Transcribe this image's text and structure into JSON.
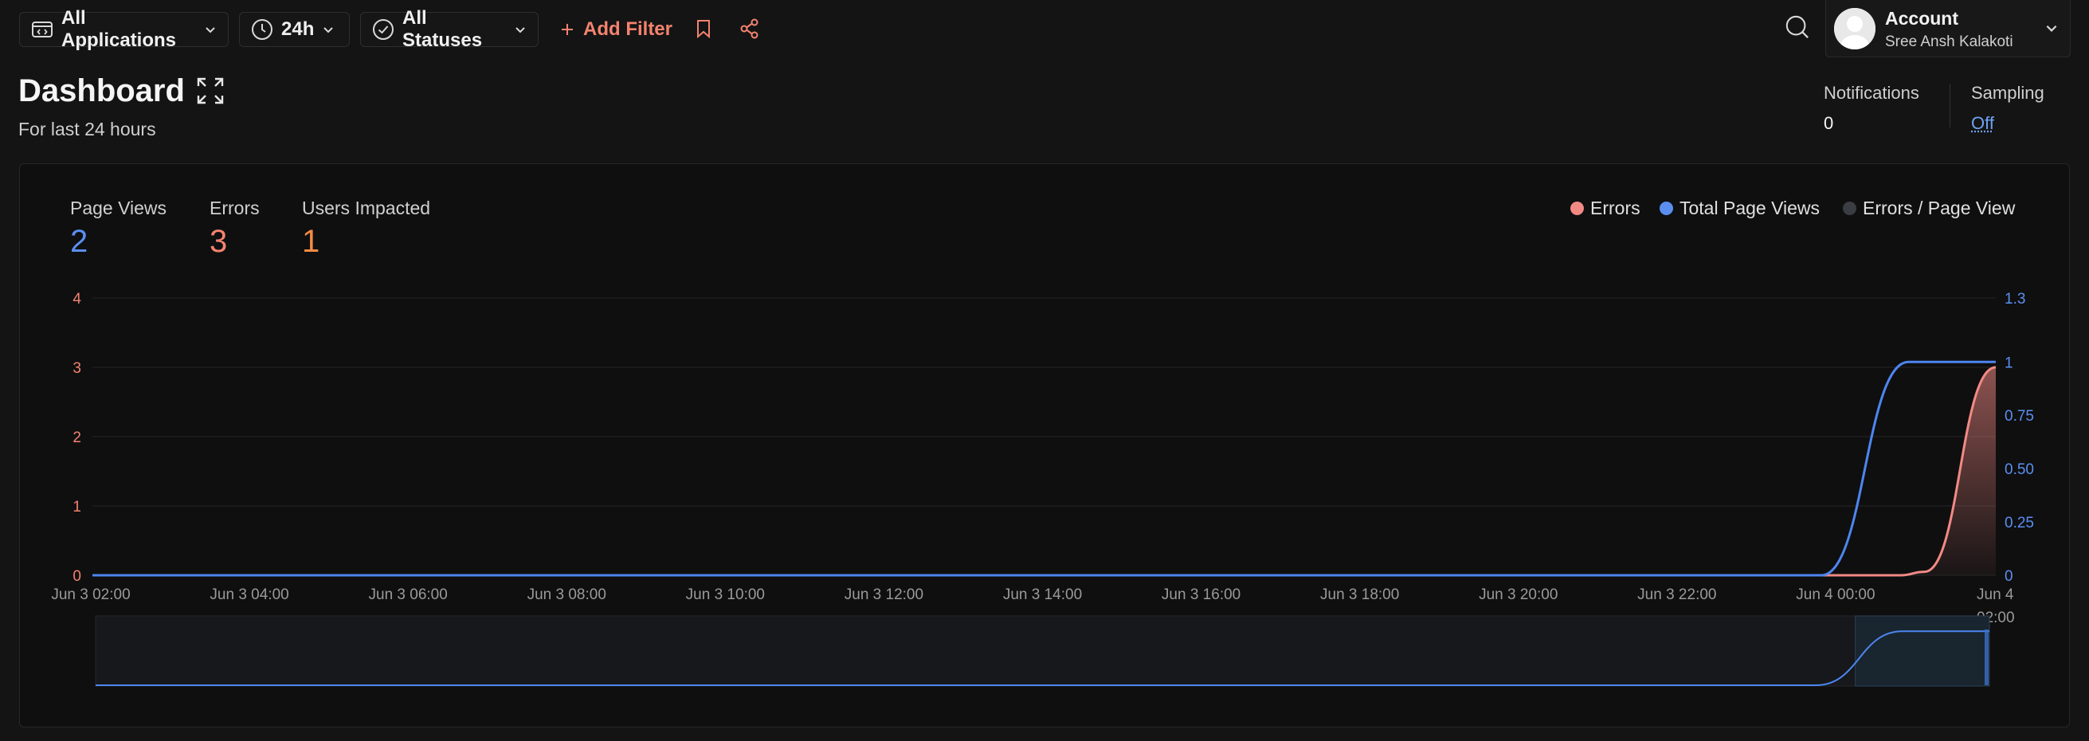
{
  "toolbar": {
    "applications_label": "All Applications",
    "timerange_label": "24h",
    "statuses_label": "All Statuses",
    "add_filter_label": "Add Filter"
  },
  "account": {
    "title": "Account",
    "user_name": "Sree Ansh Kalakoti"
  },
  "header": {
    "title": "Dashboard",
    "subtitle": "For last 24 hours",
    "notifications_label": "Notifications",
    "notifications_value": "0",
    "sampling_label": "Sampling",
    "sampling_value": "Off"
  },
  "metrics": [
    {
      "label": "Page Views",
      "value": "2",
      "color": "#5a8ff0"
    },
    {
      "label": "Errors",
      "value": "3",
      "color": "#f4836f"
    },
    {
      "label": "Users Impacted",
      "value": "1",
      "color": "#f28b43"
    }
  ],
  "legend": [
    {
      "label": "Errors",
      "color": "#f28a84"
    },
    {
      "label": "Total Page Views",
      "color": "#5a8ff0"
    },
    {
      "label": "Errors / Page View",
      "color": "#3a3d42"
    }
  ],
  "colors": {
    "errors": "#f28a84",
    "page_views": "#4d86f0",
    "left_axis_text": "#f4836f",
    "right_axis_text": "#5a8ff0"
  },
  "chart_data": {
    "type": "area",
    "x_ticks": [
      "Jun 3 02:00",
      "Jun 3 04:00",
      "Jun 3 06:00",
      "Jun 3 08:00",
      "Jun 3 10:00",
      "Jun 3 12:00",
      "Jun 3 14:00",
      "Jun 3 16:00",
      "Jun 3 18:00",
      "Jun 3 20:00",
      "Jun 3 22:00",
      "Jun 4 00:00",
      "Jun 4 02:00"
    ],
    "xlim_hours": [
      0,
      24
    ],
    "y_left": {
      "ticks": [
        "0",
        "1",
        "2",
        "3",
        "4"
      ],
      "ylim": [
        0,
        4
      ]
    },
    "y_right": {
      "ticks": [
        "0",
        "0.25",
        "0.50",
        "0.75",
        "1",
        "1.3"
      ],
      "tick_values": [
        0,
        0.25,
        0.5,
        0.75,
        1,
        1.3
      ],
      "ylim": [
        0,
        1.3
      ]
    },
    "series": [
      {
        "name": "Errors",
        "axis": "left",
        "fill": true,
        "x": [
          0,
          22.8,
          23.1,
          24
        ],
        "values": [
          0,
          0,
          0.05,
          3
        ]
      },
      {
        "name": "Total Page Views",
        "axis": "right",
        "fill": false,
        "x": [
          0,
          21.8,
          22.9,
          24
        ],
        "values": [
          0,
          0,
          1,
          1
        ]
      }
    ],
    "brush_range_hours": [
      22.3,
      24
    ],
    "grid": true
  }
}
